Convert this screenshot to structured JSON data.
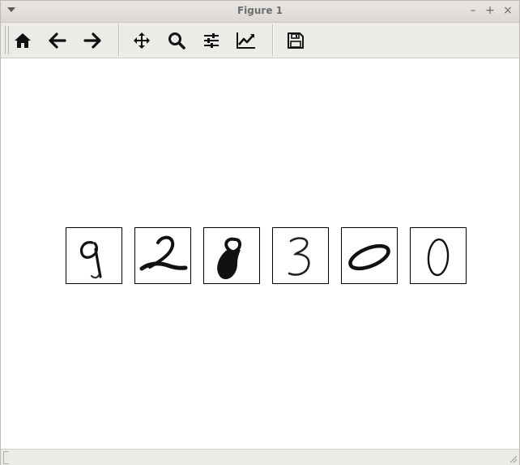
{
  "window": {
    "title": "Figure 1",
    "minimize_label": "–",
    "maximize_label": "+",
    "close_label": "×"
  },
  "toolbar": {
    "buttons": [
      {
        "icon": "home-icon"
      },
      {
        "icon": "back-arrow-icon"
      },
      {
        "icon": "forward-arrow-icon"
      },
      {
        "icon": "pan-icon"
      },
      {
        "icon": "zoom-icon"
      },
      {
        "icon": "configure-subplots-icon"
      },
      {
        "icon": "edit-axes-icon"
      },
      {
        "icon": "save-icon"
      }
    ]
  },
  "figure": {
    "images": [
      {
        "digit": "9"
      },
      {
        "digit": "2"
      },
      {
        "digit": "8"
      },
      {
        "digit": "3"
      },
      {
        "digit": "0"
      },
      {
        "digit": "0"
      }
    ]
  },
  "colors": {
    "titlebar": "#dcd9d5",
    "toolbar": "#ecebe8",
    "canvas": "#ffffff",
    "ink": "#000000"
  }
}
